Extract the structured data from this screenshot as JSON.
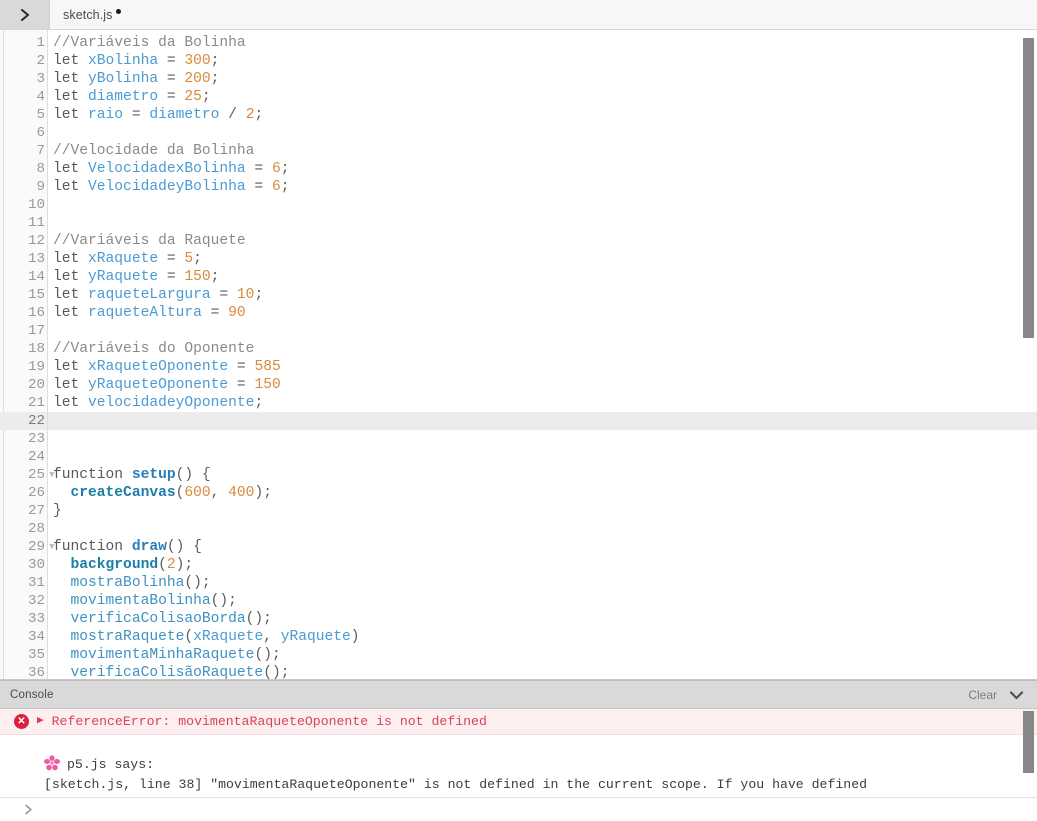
{
  "tabbar": {
    "toggle_icon": "chevron-right-icon",
    "file_name": "sketch.js",
    "unsaved_indicator": "•"
  },
  "editor": {
    "first_visible_line": 1,
    "active_line": 22,
    "fold_lines": [
      25,
      29
    ],
    "lines": [
      {
        "n": 1,
        "tokens": [
          {
            "t": "com",
            "v": "//Variáveis da Bolinha"
          }
        ]
      },
      {
        "n": 2,
        "tokens": [
          {
            "t": "kw",
            "v": "let "
          },
          {
            "t": "var",
            "v": "xBolinha"
          },
          {
            "t": "op",
            "v": " = "
          },
          {
            "t": "num",
            "v": "300"
          },
          {
            "t": "pun",
            "v": ";"
          }
        ]
      },
      {
        "n": 3,
        "tokens": [
          {
            "t": "kw",
            "v": "let "
          },
          {
            "t": "var",
            "v": "yBolinha"
          },
          {
            "t": "op",
            "v": " = "
          },
          {
            "t": "num",
            "v": "200"
          },
          {
            "t": "pun",
            "v": ";"
          }
        ]
      },
      {
        "n": 4,
        "tokens": [
          {
            "t": "kw",
            "v": "let "
          },
          {
            "t": "var",
            "v": "diametro"
          },
          {
            "t": "op",
            "v": " = "
          },
          {
            "t": "num",
            "v": "25"
          },
          {
            "t": "pun",
            "v": ";"
          }
        ]
      },
      {
        "n": 5,
        "tokens": [
          {
            "t": "kw",
            "v": "let "
          },
          {
            "t": "var",
            "v": "raio"
          },
          {
            "t": "op",
            "v": " = "
          },
          {
            "t": "var",
            "v": "diametro"
          },
          {
            "t": "op",
            "v": " / "
          },
          {
            "t": "num",
            "v": "2"
          },
          {
            "t": "pun",
            "v": ";"
          }
        ]
      },
      {
        "n": 6,
        "tokens": []
      },
      {
        "n": 7,
        "tokens": [
          {
            "t": "com",
            "v": "//Velocidade da Bolinha"
          }
        ]
      },
      {
        "n": 8,
        "tokens": [
          {
            "t": "kw",
            "v": "let "
          },
          {
            "t": "var",
            "v": "VelocidadexBolinha"
          },
          {
            "t": "op",
            "v": " = "
          },
          {
            "t": "num",
            "v": "6"
          },
          {
            "t": "pun",
            "v": ";"
          }
        ]
      },
      {
        "n": 9,
        "tokens": [
          {
            "t": "kw",
            "v": "let "
          },
          {
            "t": "var",
            "v": "VelocidadeyBolinha"
          },
          {
            "t": "op",
            "v": " = "
          },
          {
            "t": "num",
            "v": "6"
          },
          {
            "t": "pun",
            "v": ";"
          }
        ]
      },
      {
        "n": 10,
        "tokens": []
      },
      {
        "n": 11,
        "tokens": []
      },
      {
        "n": 12,
        "tokens": [
          {
            "t": "com",
            "v": "//Variáveis da Raquete"
          }
        ]
      },
      {
        "n": 13,
        "tokens": [
          {
            "t": "kw",
            "v": "let "
          },
          {
            "t": "var",
            "v": "xRaquete"
          },
          {
            "t": "op",
            "v": " = "
          },
          {
            "t": "num",
            "v": "5"
          },
          {
            "t": "pun",
            "v": ";"
          }
        ]
      },
      {
        "n": 14,
        "tokens": [
          {
            "t": "kw",
            "v": "let "
          },
          {
            "t": "var",
            "v": "yRaquete"
          },
          {
            "t": "op",
            "v": " = "
          },
          {
            "t": "num",
            "v": "150"
          },
          {
            "t": "pun",
            "v": ";"
          }
        ]
      },
      {
        "n": 15,
        "tokens": [
          {
            "t": "kw",
            "v": "let "
          },
          {
            "t": "var",
            "v": "raqueteLargura"
          },
          {
            "t": "op",
            "v": " = "
          },
          {
            "t": "num",
            "v": "10"
          },
          {
            "t": "pun",
            "v": ";"
          }
        ]
      },
      {
        "n": 16,
        "tokens": [
          {
            "t": "kw",
            "v": "let "
          },
          {
            "t": "var",
            "v": "raqueteAltura"
          },
          {
            "t": "op",
            "v": " = "
          },
          {
            "t": "num",
            "v": "90"
          }
        ]
      },
      {
        "n": 17,
        "tokens": []
      },
      {
        "n": 18,
        "tokens": [
          {
            "t": "com",
            "v": "//Variáveis do Oponente"
          }
        ]
      },
      {
        "n": 19,
        "tokens": [
          {
            "t": "kw",
            "v": "let "
          },
          {
            "t": "var",
            "v": "xRaqueteOponente"
          },
          {
            "t": "op",
            "v": " = "
          },
          {
            "t": "num",
            "v": "585"
          }
        ]
      },
      {
        "n": 20,
        "tokens": [
          {
            "t": "kw",
            "v": "let "
          },
          {
            "t": "var",
            "v": "yRaqueteOponente"
          },
          {
            "t": "op",
            "v": " = "
          },
          {
            "t": "num",
            "v": "150"
          }
        ]
      },
      {
        "n": 21,
        "tokens": [
          {
            "t": "kw",
            "v": "let "
          },
          {
            "t": "var",
            "v": "velocidadeyOponente"
          },
          {
            "t": "pun",
            "v": ";"
          }
        ]
      },
      {
        "n": 22,
        "tokens": []
      },
      {
        "n": 23,
        "tokens": []
      },
      {
        "n": 24,
        "tokens": []
      },
      {
        "n": 25,
        "tokens": [
          {
            "t": "kw",
            "v": "function "
          },
          {
            "t": "fnname",
            "v": "setup"
          },
          {
            "t": "pun",
            "v": "() {"
          }
        ]
      },
      {
        "n": 26,
        "tokens": [
          {
            "t": "pun",
            "v": "  "
          },
          {
            "t": "fn",
            "v": "createCanvas"
          },
          {
            "t": "pun",
            "v": "("
          },
          {
            "t": "num",
            "v": "600"
          },
          {
            "t": "pun",
            "v": ", "
          },
          {
            "t": "num",
            "v": "400"
          },
          {
            "t": "pun",
            "v": ");"
          }
        ]
      },
      {
        "n": 27,
        "tokens": [
          {
            "t": "pun",
            "v": "}"
          }
        ]
      },
      {
        "n": 28,
        "tokens": []
      },
      {
        "n": 29,
        "tokens": [
          {
            "t": "kw",
            "v": "function "
          },
          {
            "t": "fnname",
            "v": "draw"
          },
          {
            "t": "pun",
            "v": "() {"
          }
        ]
      },
      {
        "n": 30,
        "tokens": [
          {
            "t": "pun",
            "v": "  "
          },
          {
            "t": "fn",
            "v": "background"
          },
          {
            "t": "pun",
            "v": "("
          },
          {
            "t": "num",
            "v": "2"
          },
          {
            "t": "pun",
            "v": ");"
          }
        ]
      },
      {
        "n": 31,
        "tokens": [
          {
            "t": "pun",
            "v": "  "
          },
          {
            "t": "call",
            "v": "mostraBolinha"
          },
          {
            "t": "pun",
            "v": "();"
          }
        ]
      },
      {
        "n": 32,
        "tokens": [
          {
            "t": "pun",
            "v": "  "
          },
          {
            "t": "call",
            "v": "movimentaBolinha"
          },
          {
            "t": "pun",
            "v": "();"
          }
        ]
      },
      {
        "n": 33,
        "tokens": [
          {
            "t": "pun",
            "v": "  "
          },
          {
            "t": "call",
            "v": "verificaColisaoBorda"
          },
          {
            "t": "pun",
            "v": "();"
          }
        ]
      },
      {
        "n": 34,
        "tokens": [
          {
            "t": "pun",
            "v": "  "
          },
          {
            "t": "call",
            "v": "mostraRaquete"
          },
          {
            "t": "pun",
            "v": "("
          },
          {
            "t": "var",
            "v": "xRaquete"
          },
          {
            "t": "pun",
            "v": ", "
          },
          {
            "t": "var",
            "v": "yRaquete"
          },
          {
            "t": "pun",
            "v": ")"
          }
        ]
      },
      {
        "n": 35,
        "tokens": [
          {
            "t": "pun",
            "v": "  "
          },
          {
            "t": "call",
            "v": "movimentaMinhaRaquete"
          },
          {
            "t": "pun",
            "v": "();"
          }
        ]
      },
      {
        "n": 36,
        "tokens": [
          {
            "t": "pun",
            "v": "  "
          },
          {
            "t": "call",
            "v": "verificaColisãoRaquete"
          },
          {
            "t": "pun",
            "v": "();"
          }
        ]
      }
    ]
  },
  "console": {
    "title": "Console",
    "clear_label": "Clear",
    "collapse_icon": "chevron-down-icon",
    "error": {
      "status_icon": "error-circle-icon",
      "expand_icon": "caret-right-icon",
      "message": "ReferenceError: movimentaRaqueteOponente is not defined"
    },
    "detail": {
      "logo_icon": "p5-flower-icon",
      "says_label": "p5.js says:",
      "body": "[sketch.js, line 38] \"movimentaRaqueteOponente\" is not defined in the current scope. If you have defined"
    },
    "prompt_icon": "chevron-right-icon"
  },
  "colors": {
    "error_red": "#d9435b",
    "error_bg": "#fdeff0",
    "accent_blue": "#4a9bd4",
    "number_orange": "#d98a3d",
    "comment_gray": "#8a8a8a",
    "console_header": "#d9d9d9"
  }
}
